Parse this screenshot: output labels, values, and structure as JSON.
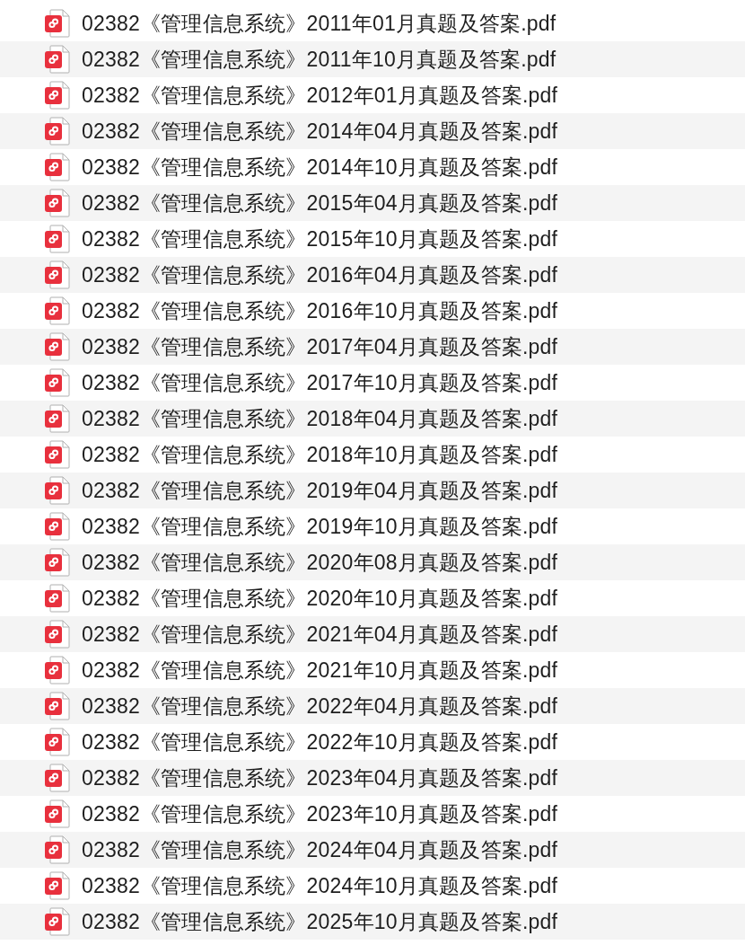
{
  "files": [
    {
      "name": "02382《管理信息系统》2011年01月真题及答案.pdf"
    },
    {
      "name": "02382《管理信息系统》2011年10月真题及答案.pdf"
    },
    {
      "name": "02382《管理信息系统》2012年01月真题及答案.pdf"
    },
    {
      "name": "02382《管理信息系统》2014年04月真题及答案.pdf"
    },
    {
      "name": "02382《管理信息系统》2014年10月真题及答案.pdf"
    },
    {
      "name": "02382《管理信息系统》2015年04月真题及答案.pdf"
    },
    {
      "name": "02382《管理信息系统》2015年10月真题及答案.pdf"
    },
    {
      "name": "02382《管理信息系统》2016年04月真题及答案.pdf"
    },
    {
      "name": "02382《管理信息系统》2016年10月真题及答案.pdf"
    },
    {
      "name": "02382《管理信息系统》2017年04月真题及答案.pdf"
    },
    {
      "name": "02382《管理信息系统》2017年10月真题及答案.pdf"
    },
    {
      "name": "02382《管理信息系统》2018年04月真题及答案.pdf"
    },
    {
      "name": "02382《管理信息系统》2018年10月真题及答案.pdf"
    },
    {
      "name": "02382《管理信息系统》2019年04月真题及答案.pdf"
    },
    {
      "name": "02382《管理信息系统》2019年10月真题及答案.pdf"
    },
    {
      "name": "02382《管理信息系统》2020年08月真题及答案.pdf"
    },
    {
      "name": "02382《管理信息系统》2020年10月真题及答案.pdf"
    },
    {
      "name": "02382《管理信息系统》2021年04月真题及答案.pdf"
    },
    {
      "name": "02382《管理信息系统》2021年10月真题及答案.pdf"
    },
    {
      "name": "02382《管理信息系统》2022年04月真题及答案.pdf"
    },
    {
      "name": "02382《管理信息系统》2022年10月真题及答案.pdf"
    },
    {
      "name": "02382《管理信息系统》2023年04月真题及答案.pdf"
    },
    {
      "name": "02382《管理信息系统》2023年10月真题及答案.pdf"
    },
    {
      "name": "02382《管理信息系统》2024年04月真题及答案.pdf"
    },
    {
      "name": "02382《管理信息系统》2024年10月真题及答案.pdf"
    },
    {
      "name": "02382《管理信息系统》2025年10月真题及答案.pdf"
    }
  ]
}
